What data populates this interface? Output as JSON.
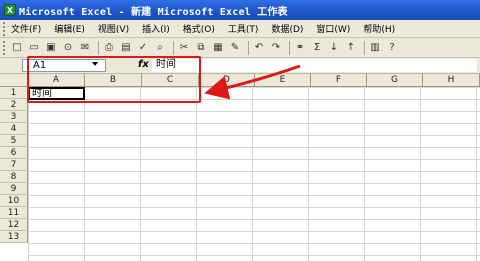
{
  "window": {
    "title": "Microsoft Excel - 新建 Microsoft Excel 工作表",
    "app_icon": "excel-icon"
  },
  "menubar": {
    "items": [
      {
        "label": "文件(F)"
      },
      {
        "label": "编辑(E)"
      },
      {
        "label": "视图(V)"
      },
      {
        "label": "插入(I)"
      },
      {
        "label": "格式(O)"
      },
      {
        "label": "工具(T)"
      },
      {
        "label": "数据(D)"
      },
      {
        "label": "窗口(W)"
      },
      {
        "label": "帮助(H)"
      }
    ]
  },
  "toolbar": {
    "icons": [
      "new-icon",
      "open-icon",
      "save-icon",
      "permission-icon",
      "email-icon",
      "print-icon",
      "print-preview-icon",
      "spelling-icon",
      "research-icon",
      "cut-icon",
      "copy-icon",
      "paste-icon",
      "format-painter-icon",
      "undo-icon",
      "redo-icon",
      "hyperlink-icon",
      "autosum-icon",
      "sort-ascending-icon",
      "sort-descending-icon",
      "chart-wizard-icon",
      "help-icon"
    ],
    "glyphs": [
      "□",
      "▭",
      "▣",
      "⊙",
      "✉",
      "⎙",
      "▤",
      "✓",
      "⌕",
      "✂",
      "⧉",
      "▦",
      "✎",
      "↶",
      "↷",
      "⚭",
      "Σ",
      "↓",
      "↑",
      "▥",
      "?"
    ]
  },
  "formula_bar": {
    "name_box": "A1",
    "fx_label": "fx",
    "content": "时间"
  },
  "grid": {
    "columns": [
      "A",
      "B",
      "C",
      "D",
      "E",
      "F",
      "G",
      "H"
    ],
    "rows": [
      "1",
      "2",
      "3",
      "4",
      "5",
      "6",
      "7",
      "8",
      "9",
      "10",
      "11",
      "12",
      "13"
    ],
    "cell_a1": "时间"
  },
  "colors": {
    "highlight": "#e01818",
    "titlebar": "#1f56c9"
  }
}
